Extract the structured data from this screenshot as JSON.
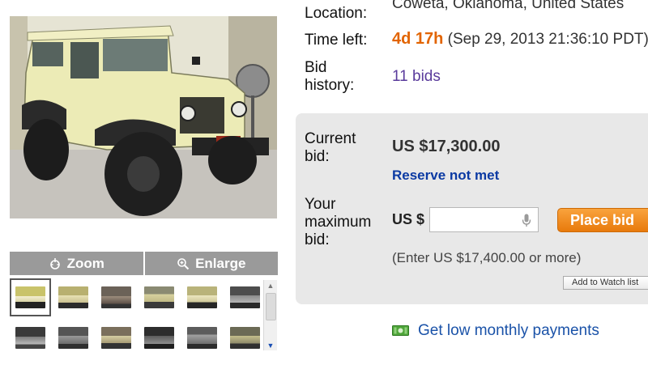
{
  "gallery": {
    "zoom_label": "Zoom",
    "enlarge_label": "Enlarge",
    "thumbnails": [
      "t0",
      "t1",
      "t2",
      "t3",
      "t4",
      "t5",
      "t6",
      "t7",
      "t8",
      "t9",
      "t10",
      "t11"
    ],
    "selected_thumbnail": 0
  },
  "details": {
    "location_label": "Location:",
    "location_value": "Coweta, Oklahoma, United States",
    "time_left_label": "Time left:",
    "time_left_value": "4d 17h",
    "time_left_date": "(Sep 29, 2013 21:36:10 PDT)",
    "bid_history_label_1": "Bid",
    "bid_history_label_2": "history:",
    "bids_count": "11 bids"
  },
  "bidding": {
    "current_bid_label_1": "Current",
    "current_bid_label_2": "bid:",
    "current_bid_value": "US $17,300.00",
    "reserve_status": "Reserve not met",
    "max_bid_label_1": "Your",
    "max_bid_label_2": "maximum",
    "max_bid_label_3": "bid:",
    "currency_prefix": "US $",
    "bid_input_value": "",
    "place_bid_label": "Place bid",
    "min_bid_hint": "(Enter US $17,400.00 or more)",
    "watch_list_label": "Add to Watch list"
  },
  "financing": {
    "payments_link": "Get low monthly payments"
  },
  "colors": {
    "time_left": "#e26400",
    "bids_link": "#5a3b9c",
    "reserve": "#0b3aa3",
    "place_bid": "#f08a1c",
    "payments_link": "#1a52a8"
  }
}
